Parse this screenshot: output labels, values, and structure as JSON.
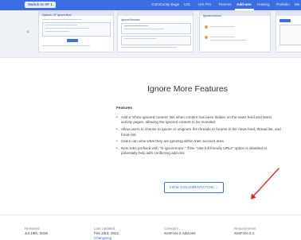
{
  "topbar": {
    "switch_label": "Switch to XF 1",
    "nav": [
      {
        "label": "Community Bugs"
      },
      {
        "label": "UIX"
      },
      {
        "label": "UIX Pro"
      },
      {
        "label": "Themes"
      },
      {
        "label": "Add-ons"
      },
      {
        "label": "Hosting"
      },
      {
        "label": "Portfolio"
      },
      {
        "label": "Me"
      }
    ],
    "active_nav": "Add-ons"
  },
  "gallery": {
    "prev_icon": "chevron-left-icon",
    "thumb1_title": "Options, XF Ignore More",
    "thumb2_title": "Ignored threads",
    "thumb2_sub": "Ignored forums"
  },
  "section": {
    "title": "Ignore More Features",
    "features_heading": "Features",
    "features": [
      "Add a 'Show ignored content' link when content has been hidden on the news feed and latest activity pages, allowing the ignored content to be revealed",
      "Allow users to choose to ignore or unignore the threads or forums in the news feed, thread list, and forum list",
      "Users can view what they are ignoring within their account area",
      "New links prefixed with \"/ir-ignoremore-\" if the \"Use full friendly URLs\" option is disabled to potentially help with conflicting add-ons"
    ],
    "doc_button": "VIEW DOCUMENTATION →"
  },
  "meta": {
    "released_label": "Released",
    "released_value": "Jul 19th, 2019",
    "updated_label": "Last Updated",
    "updated_value": "Feb 23rd, 2021",
    "updated_link": "Changelog",
    "category_label": "Category",
    "category_value": "XenForo 2 Add-ons",
    "requirements_label": "Requirements",
    "requirements_value": "XenForo 2.1"
  },
  "colors": {
    "accent": "#3b6ee3",
    "annotation_arrow": "#e0271e"
  }
}
